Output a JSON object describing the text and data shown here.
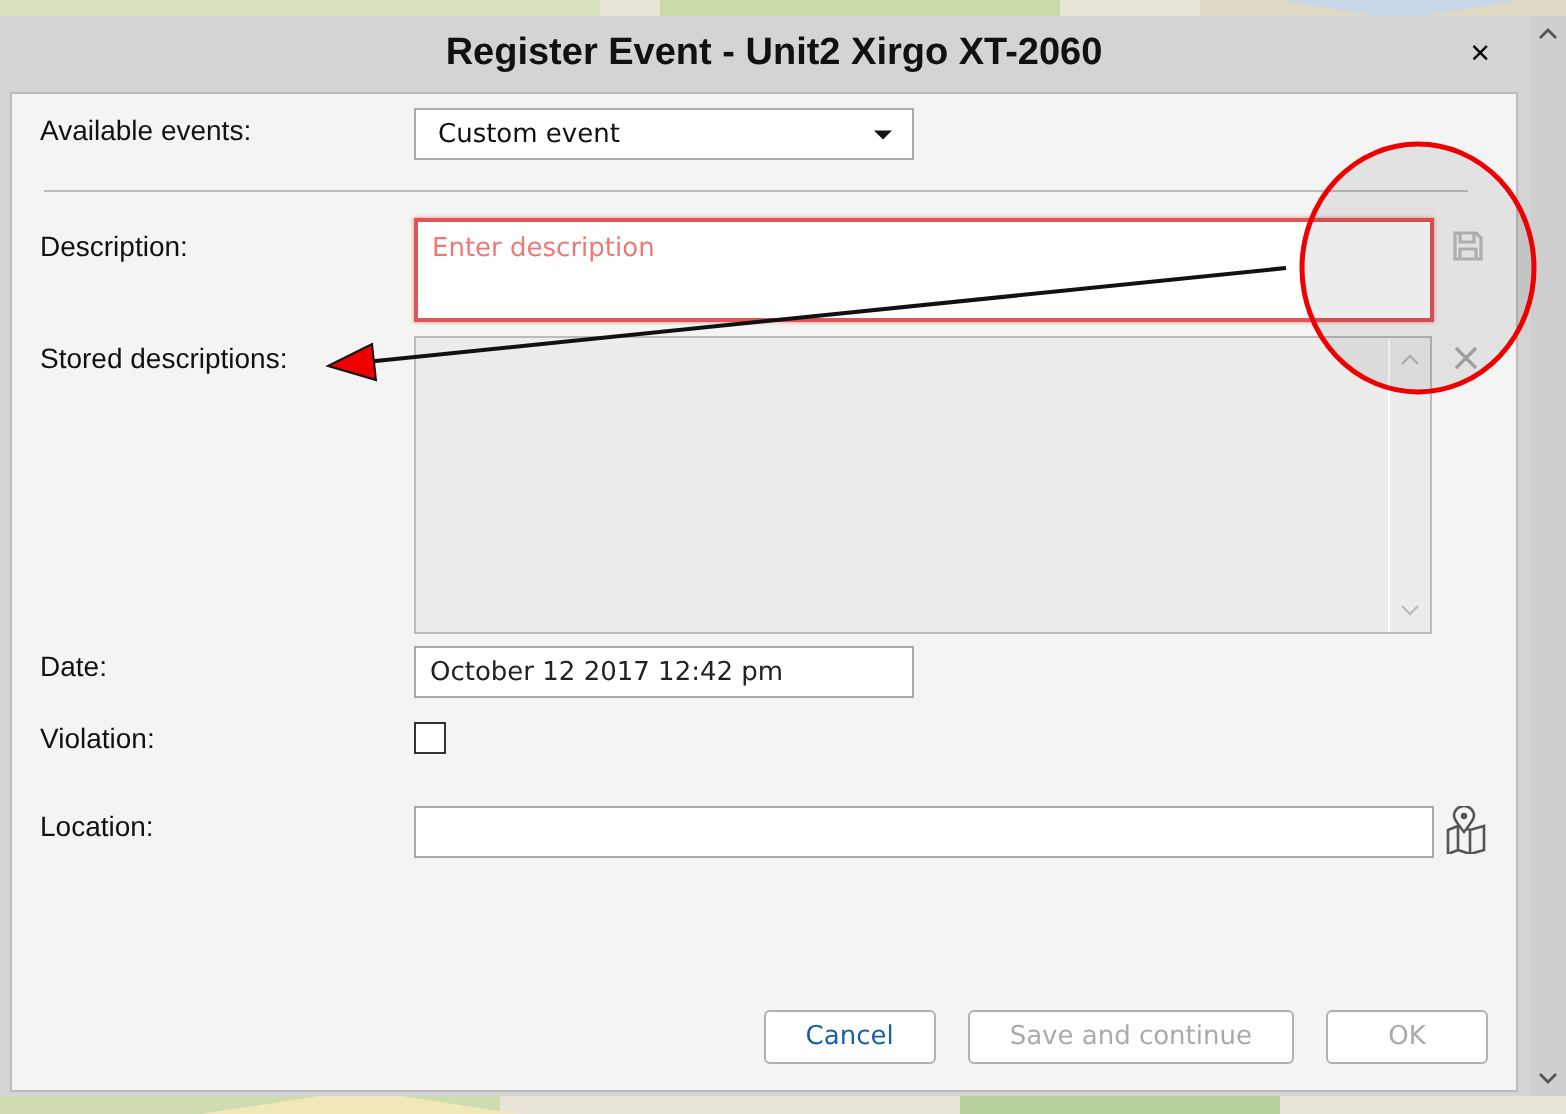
{
  "dialog": {
    "title": "Register Event - Unit2 Xirgo XT-2060",
    "close": "×"
  },
  "fields": [
    {
      "kind": "select",
      "label": "Available events:",
      "value": "Custom event"
    },
    {
      "kind": "divider"
    },
    {
      "kind": "textarea",
      "label": "Description:",
      "placeholder": "Enter description",
      "invalid": true
    },
    {
      "kind": "list",
      "label": "Stored descriptions:",
      "disabled": true
    },
    {
      "kind": "text",
      "label": "Date:",
      "value": "October 12 2017 12:42 pm"
    },
    {
      "kind": "checkbox",
      "label": "Violation:",
      "checked": false
    },
    {
      "kind": "location",
      "label": "Location:"
    }
  ],
  "buttons": [
    {
      "label": "Cancel",
      "disabled": false
    },
    {
      "label": "Save and continue",
      "disabled": true
    },
    {
      "label": "OK",
      "disabled": true
    }
  ]
}
